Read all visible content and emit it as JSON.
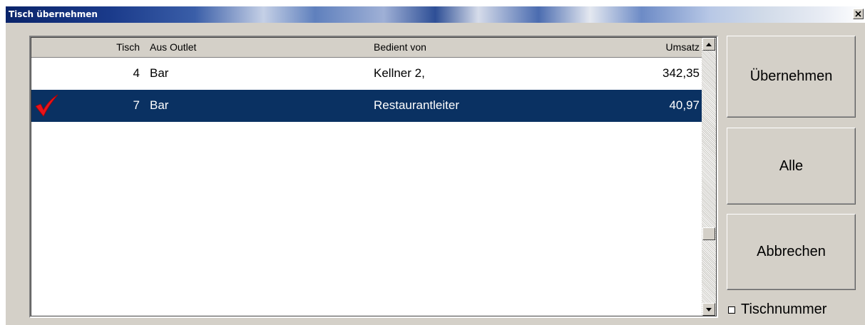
{
  "window": {
    "title": "Tisch übernehmen"
  },
  "list": {
    "columns": {
      "tisch": "Tisch",
      "outlet": "Aus Outlet",
      "bedient": "Bedient von",
      "umsatz": "Umsatz"
    },
    "rows": [
      {
        "tisch": "4",
        "outlet": "Bar",
        "bedient": "Kellner 2,",
        "umsatz": "342,35",
        "selected": false,
        "checked": false
      },
      {
        "tisch": "7",
        "outlet": "Bar",
        "bedient": "Restaurantleiter",
        "umsatz": "40,97",
        "selected": true,
        "checked": true
      }
    ]
  },
  "buttons": {
    "ok": "Übernehmen",
    "all": "Alle",
    "cancel": "Abbrechen"
  },
  "checkbox": {
    "label": "Tischnummer",
    "checked": false
  },
  "colors": {
    "selection": "#0a3162",
    "checkmark": "#e8141c",
    "title_gradient_start": "#0a246a"
  },
  "icons": {
    "close": "close-icon",
    "check": "checkmark-icon",
    "scroll_up": "arrow-up-icon",
    "scroll_down": "arrow-down-icon"
  }
}
